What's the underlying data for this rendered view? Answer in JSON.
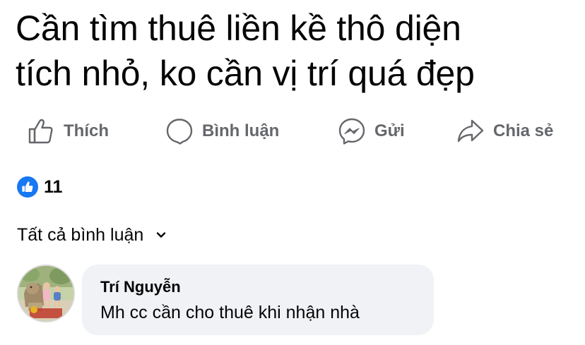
{
  "post": {
    "text_line1": "Cần tìm thuê liền kề thô diện",
    "text_line2": "tích nhỏ, ko cần vị trí quá đẹp"
  },
  "actions": {
    "like_label": "Thích",
    "comment_label": "Bình luận",
    "send_label": "Gửi",
    "share_label": "Chia sẻ"
  },
  "reactions": {
    "count": "11",
    "icon": "like-thumb-icon",
    "color": "#1877f2"
  },
  "comments_filter": {
    "label": "Tất cả bình luận"
  },
  "comments": [
    {
      "author": "Trí Nguyễn",
      "text": "Mh cc cần cho thuê khi nhận nhà"
    }
  ],
  "colors": {
    "text": "#050505",
    "secondary": "#65676b",
    "bubble_bg": "#f0f2f5",
    "brand": "#1877f2"
  }
}
